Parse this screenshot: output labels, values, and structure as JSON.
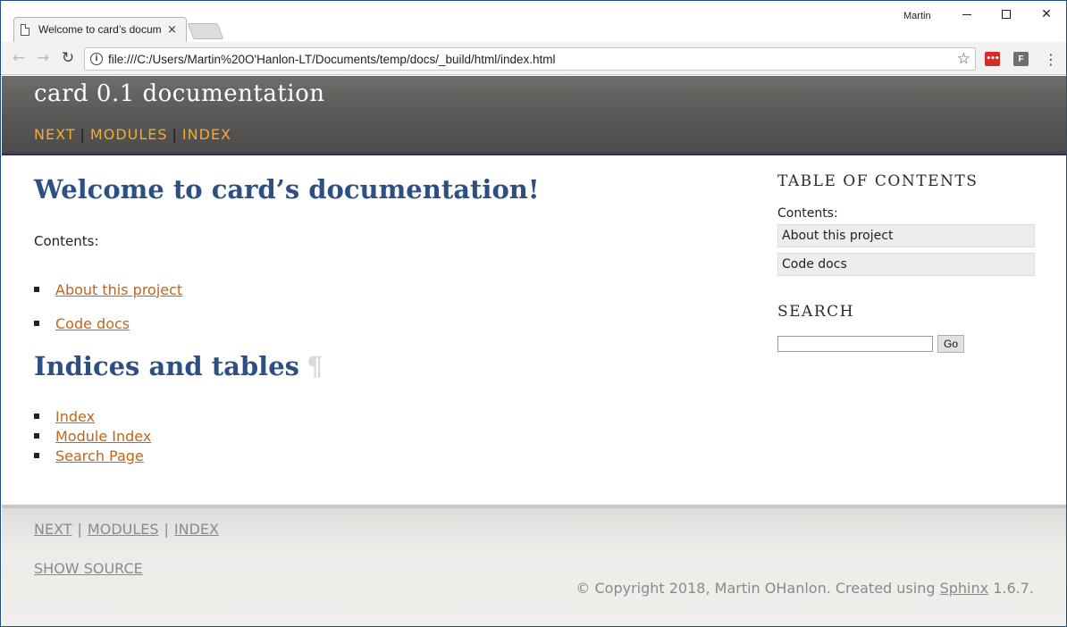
{
  "browser": {
    "tab_title": "Welcome to card’s docum",
    "tab_close": "×",
    "user": "Martin",
    "url": "file:///C:/Users/Martin%20O'Hanlon-LT/Documents/temp/docs/_build/html/index.html",
    "icons": {
      "back": "back-arrow-icon",
      "forward": "forward-arrow-icon",
      "reload": "reload-icon",
      "info": "info-icon",
      "star": "star-icon",
      "lastpass": "lastpass-icon",
      "extension_f": "extension-f-icon",
      "menu": "menu-dots-icon"
    },
    "ext_lastpass_label": "•••",
    "ext_f_label": "F",
    "go_glyphs": {
      "back": "←",
      "forward": "→",
      "reload": "↻",
      "info": "i",
      "star": "☆",
      "menu": "⋮",
      "close": "✕"
    }
  },
  "header": {
    "title": "card 0.1 documentation",
    "nav": [
      "NEXT",
      "MODULES",
      "INDEX"
    ],
    "separator": "|",
    "colors": {
      "bar": "#5d5e5b",
      "nav_link": "#f7a833",
      "underline": "#46465a"
    }
  },
  "main": {
    "heading": "Welcome to card’s documentation!",
    "contents_label": "Contents:",
    "toc": [
      "About this project",
      "Code docs"
    ],
    "indices_heading": "Indices and tables",
    "pilcrow": "¶",
    "indices": [
      "Index",
      "Module Index",
      "Search Page"
    ],
    "colors": {
      "heading": "#2e4f84",
      "link": "#c0661a"
    }
  },
  "sidebar": {
    "toc_heading": "TABLE OF CONTENTS",
    "contents_label": "Contents:",
    "items": [
      "About this project",
      "Code docs"
    ],
    "search_heading": "SEARCH",
    "search_value": "",
    "go_label": "Go"
  },
  "footer": {
    "nav": [
      "NEXT",
      "MODULES",
      "INDEX"
    ],
    "separator": "|",
    "show_source": "SHOW SOURCE",
    "copyright_prefix": "© Copyright 2018, Martin OHanlon. Created using ",
    "sphinx": "Sphinx",
    "version_suffix": " 1.6.7."
  }
}
